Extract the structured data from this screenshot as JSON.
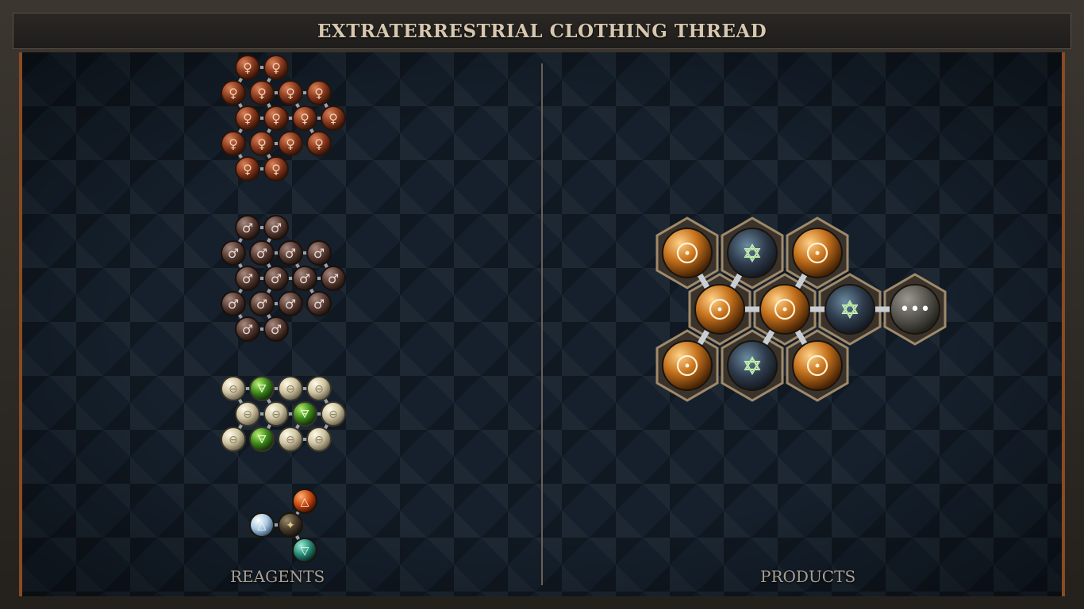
{
  "title": "EXTRATERRESTRIAL CLOTHING THREAD",
  "reagents_label": "REAGENTS",
  "products_label": "PRODUCTS",
  "reagents": [
    {
      "name": "copper-cluster",
      "element": "copper",
      "symbol": "♀",
      "color": "#8a3a1e"
    },
    {
      "name": "iron-cluster",
      "element": "iron",
      "symbol": "♂",
      "color": "#5a3e36"
    },
    {
      "name": "salt-cluster",
      "element": "salt",
      "symbol": "⊖",
      "color": "#cfc4a2"
    },
    {
      "name": "elemental-quartet",
      "element": "fire-air-earth-water",
      "symbol": "🜁",
      "color": "#c84a14"
    }
  ],
  "product": {
    "name": "product-molecule",
    "atoms": [
      "gold",
      "vitae",
      "gold",
      "gold",
      "gold",
      "vitae",
      "ellipsis",
      "gold",
      "vitae",
      "gold"
    ],
    "symbol_gold": "☉",
    "symbol_vitae": "✡",
    "symbol_more": "•••"
  }
}
